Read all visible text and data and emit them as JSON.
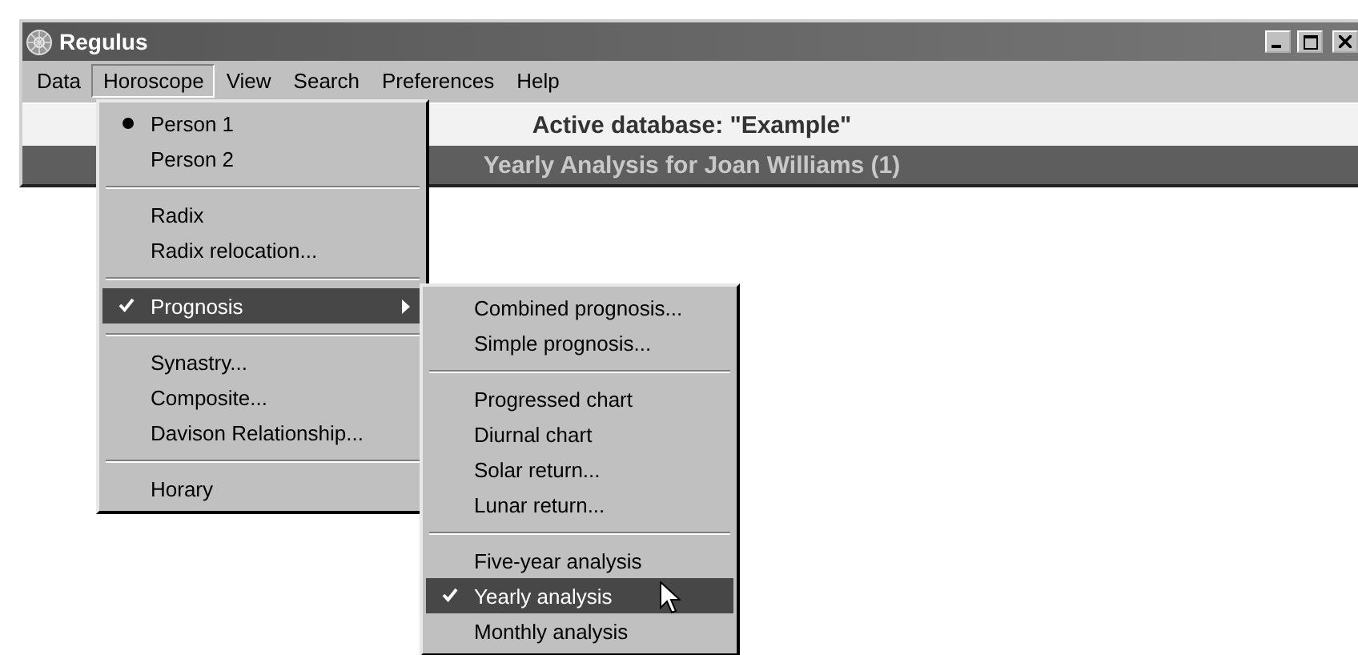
{
  "window": {
    "title": "Regulus"
  },
  "menu_bar": [
    {
      "label": "Data",
      "selected": false
    },
    {
      "label": "Horoscope",
      "selected": true
    },
    {
      "label": "View",
      "selected": false
    },
    {
      "label": "Search",
      "selected": false
    },
    {
      "label": "Preferences",
      "selected": false
    },
    {
      "label": "Help",
      "selected": false
    }
  ],
  "header": {
    "database": "Active database: \"Example\"",
    "analysis": "Yearly Analysis for Joan Williams (1)"
  },
  "horoscope_menu": {
    "items": [
      {
        "kind": "radio",
        "label": "Person 1",
        "checked": true,
        "selected": false,
        "has_submenu": false
      },
      {
        "kind": "radio",
        "label": "Person 2",
        "checked": false,
        "selected": false,
        "has_submenu": false
      },
      {
        "kind": "separator"
      },
      {
        "kind": "check",
        "label": "Radix",
        "checked": false,
        "selected": false,
        "has_submenu": false
      },
      {
        "kind": "check",
        "label": "Radix relocation...",
        "checked": false,
        "selected": false,
        "has_submenu": false
      },
      {
        "kind": "separator"
      },
      {
        "kind": "check",
        "label": "Prognosis",
        "checked": true,
        "selected": true,
        "has_submenu": true
      },
      {
        "kind": "separator"
      },
      {
        "kind": "check",
        "label": "Synastry...",
        "checked": false,
        "selected": false,
        "has_submenu": false
      },
      {
        "kind": "check",
        "label": "Composite...",
        "checked": false,
        "selected": false,
        "has_submenu": false
      },
      {
        "kind": "check",
        "label": "Davison Relationship...",
        "checked": false,
        "selected": false,
        "has_submenu": false
      },
      {
        "kind": "separator"
      },
      {
        "kind": "check",
        "label": "Horary",
        "checked": false,
        "selected": false,
        "has_submenu": false
      }
    ]
  },
  "prognosis_submenu": {
    "items": [
      {
        "kind": "check",
        "label": "Combined prognosis...",
        "checked": false,
        "selected": false
      },
      {
        "kind": "check",
        "label": "Simple prognosis...",
        "checked": false,
        "selected": false
      },
      {
        "kind": "separator"
      },
      {
        "kind": "check",
        "label": "Progressed chart",
        "checked": false,
        "selected": false
      },
      {
        "kind": "check",
        "label": "Diurnal chart",
        "checked": false,
        "selected": false
      },
      {
        "kind": "check",
        "label": "Solar return...",
        "checked": false,
        "selected": false
      },
      {
        "kind": "check",
        "label": "Lunar return...",
        "checked": false,
        "selected": false
      },
      {
        "kind": "separator"
      },
      {
        "kind": "check",
        "label": "Five-year analysis",
        "checked": false,
        "selected": false
      },
      {
        "kind": "check",
        "label": "Yearly analysis",
        "checked": true,
        "selected": true
      },
      {
        "kind": "check",
        "label": "Monthly analysis",
        "checked": false,
        "selected": false
      }
    ]
  }
}
